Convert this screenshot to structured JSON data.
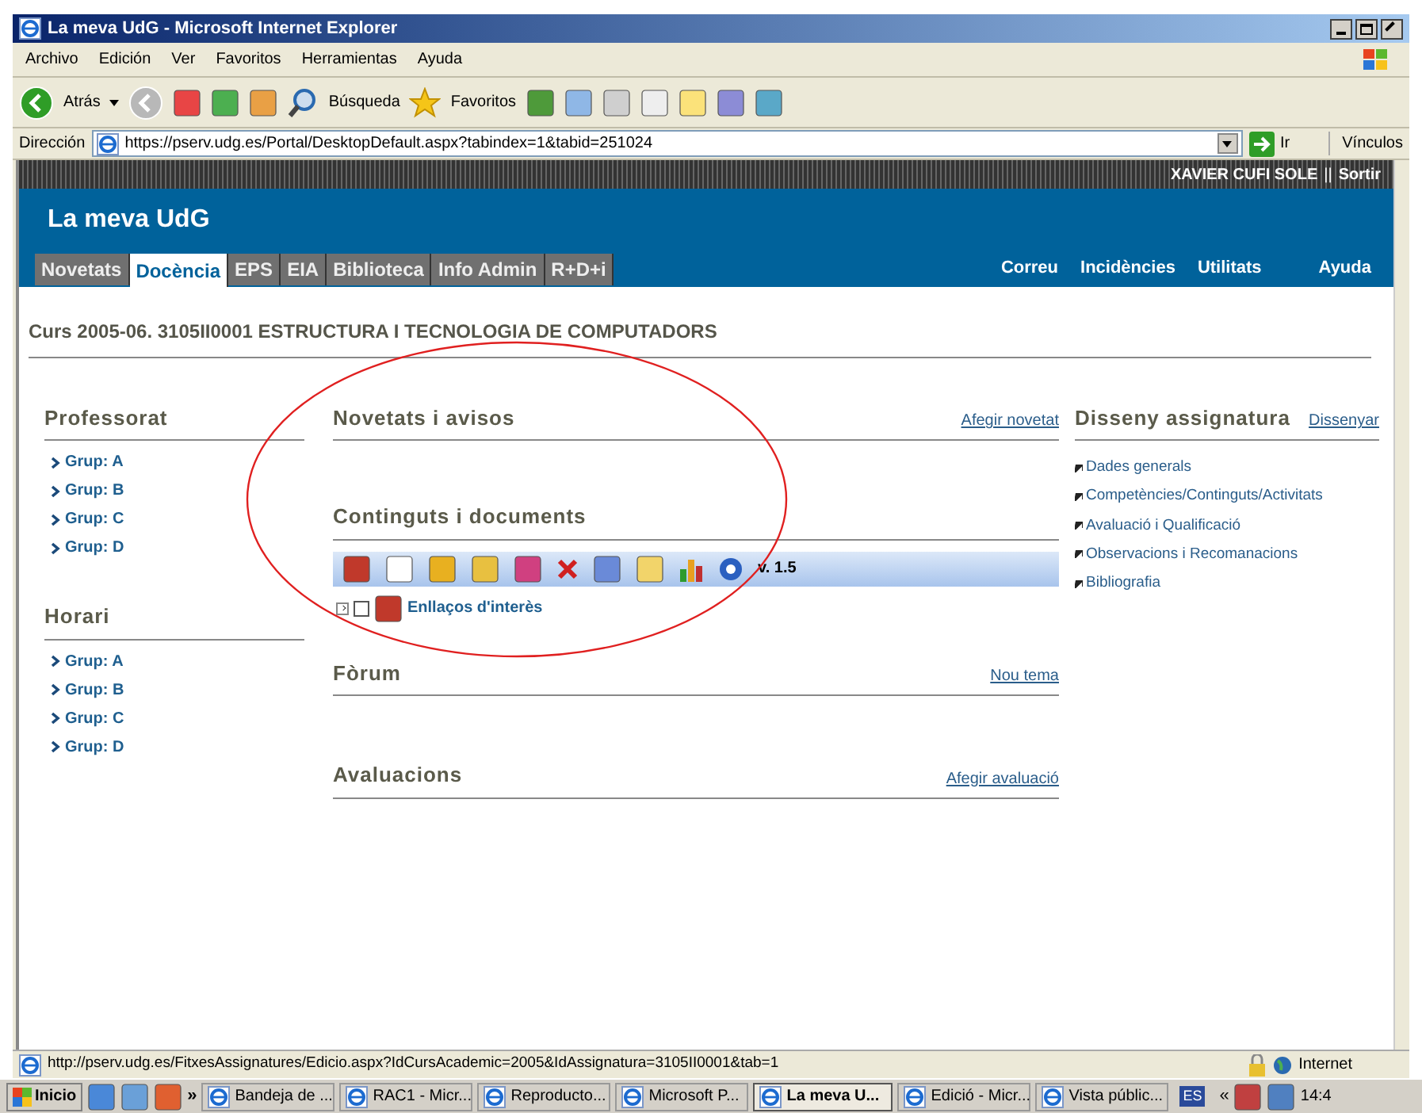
{
  "window": {
    "title": "La meva UdG - Microsoft Internet Explorer"
  },
  "menu_bar": [
    "Archivo",
    "Edición",
    "Ver",
    "Favoritos",
    "Herramientas",
    "Ayuda"
  ],
  "toolbar": {
    "back": "Atrás",
    "search": "Búsqueda",
    "favorites": "Favoritos"
  },
  "address_bar": {
    "label": "Dirección",
    "value": "https://pserv.udg.es/Portal/DesktopDefault.aspx?tabindex=1&tabid=251024",
    "go": "Ir",
    "links": "Vínculos"
  },
  "portal": {
    "user": "XAVIER CUFI SOLE",
    "separator": "||",
    "logout": "Sortir",
    "site_title": "La meva UdG",
    "tabs": [
      {
        "label": "Novetats",
        "selected": false
      },
      {
        "label": "Docència",
        "selected": true
      },
      {
        "label": "EPS",
        "selected": false
      },
      {
        "label": "EIA",
        "selected": false
      },
      {
        "label": "Biblioteca",
        "selected": false
      },
      {
        "label": "Info Admin",
        "selected": false
      },
      {
        "label": "R+D+i",
        "selected": false
      }
    ],
    "header_links": [
      "Correu",
      "Incidències",
      "Utilitats",
      "Ayuda"
    ],
    "course_title": "Curs 2005-06. 3105II0001 ESTRUCTURA I TECNOLOGIA DE COMPUTADORS",
    "left_sections": [
      {
        "title": "Professorat",
        "items": [
          "Grup: A",
          "Grup: B",
          "Grup: C",
          "Grup: D"
        ]
      },
      {
        "title": "Horari",
        "items": [
          "Grup: A",
          "Grup: B",
          "Grup: C",
          "Grup: D"
        ]
      }
    ],
    "news": {
      "title": "Novetats i avisos",
      "action": "Afegir novetat"
    },
    "contents": {
      "title": "Continguts i documents",
      "version": "v. 1.5",
      "tree": [
        {
          "label": "Enllaços d'interès",
          "checked": false,
          "expanded": false
        }
      ]
    },
    "forum": {
      "title": "Fòrum",
      "action": "Nou tema"
    },
    "evaluations": {
      "title": "Avaluacions",
      "action": "Afegir avaluació"
    },
    "design": {
      "title": "Disseny assignatura",
      "action": "Dissenyar",
      "items": [
        "Dades generals",
        "Competències/Continguts/Activitats",
        "Avaluació i Qualificació",
        "Observacions i Recomanacions",
        "Bibliografia"
      ]
    }
  },
  "status_bar": {
    "url": "http://pserv.udg.es/FitxesAssignatures/Edicio.aspx?IdCursAcademic=2005&IdAssignatura=3105II0001&tab=1",
    "zone": "Internet"
  },
  "taskbar": {
    "start": "Inicio",
    "more": "»",
    "tasks": [
      {
        "label": "Bandeja de ...",
        "selected": false
      },
      {
        "label": "RAC1 - Micr...",
        "selected": false
      },
      {
        "label": "Reproducto...",
        "selected": false
      },
      {
        "label": "Microsoft P...",
        "selected": false
      },
      {
        "label": "La meva U...",
        "selected": true
      },
      {
        "label": "Edició - Micr...",
        "selected": false
      },
      {
        "label": "Vista públic...",
        "selected": false
      }
    ],
    "language": "ES",
    "tray_expand": "«",
    "clock": "14:4"
  }
}
